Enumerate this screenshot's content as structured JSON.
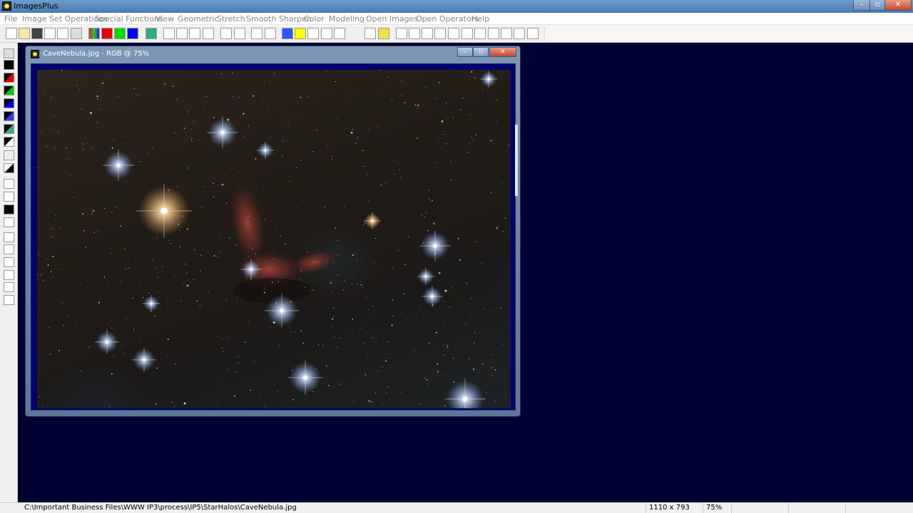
{
  "app": {
    "title": "ImagesPlus"
  },
  "menu": [
    "File",
    "Image Set Operations",
    "Special Functions",
    "View",
    "Geometric",
    "Stretch",
    "Smooth Sharpen",
    "Color",
    "Modeling",
    "Open Images",
    "Open Operators",
    "Help"
  ],
  "window_controls": {
    "minimize": "–",
    "maximize": "▫",
    "close": "✕"
  },
  "image_window": {
    "title": "CaveNebula.jpg - RGB @ 75%",
    "controls": {
      "minimize": "–",
      "maximize": "▫",
      "close": "✕"
    }
  },
  "status": {
    "path": "C:\\Important Business Files\\WWW IP3\\process\\IP5\\StarHalos\\CaveNebula.jpg",
    "dimensions": "1110 x 793",
    "zoom": "75%"
  },
  "colors": {
    "workspace": "#000033",
    "frame": "#000070",
    "nebula": "#9c3a34"
  },
  "toolbar_icons": [
    "new-icon",
    "open-icon",
    "save-icon",
    "close-red-icon",
    "close-green-icon",
    "copy-icon",
    "rgb-channels-icon",
    "red-channel-icon",
    "green-channel-icon",
    "blue-channel-icon",
    "grid-icon",
    "undo-gray-icon",
    "redo-gray-icon",
    "undo-icon",
    "redo-icon",
    "circle-icon",
    "circle-red-icon",
    "dots-icon",
    "points-icon",
    "histogram-icon",
    "curve-icon",
    "crosshair-plus-icon",
    "crosshair-icon",
    "select-icon",
    "brush-icon",
    "pencil-icon",
    "table-icon",
    "zoom-in-icon",
    "zoom-out-icon",
    "zoom-fit-icon",
    "zoom-actual-icon",
    "plus-icon",
    "minus-icon",
    "square-1-icon",
    "square-2-icon",
    "square-3-icon",
    "square-4-icon",
    "square-5-icon"
  ],
  "leftbar_icons": [
    "save-icon",
    "black-square-icon",
    "red-black-icon",
    "green-black-icon",
    "blue-black-icon",
    "blue-black2-icon",
    "green-black2-icon",
    "white-black-icon",
    "arc-icon",
    "gradient-icon",
    "rect-select-icon",
    "bars-icon",
    "bw-icon",
    "zoom-region-icon",
    "move-icon",
    "up-arrow-icon",
    "right-arrow-icon",
    "rotate-left-icon",
    "rotate-down-icon",
    "frame-icon"
  ]
}
